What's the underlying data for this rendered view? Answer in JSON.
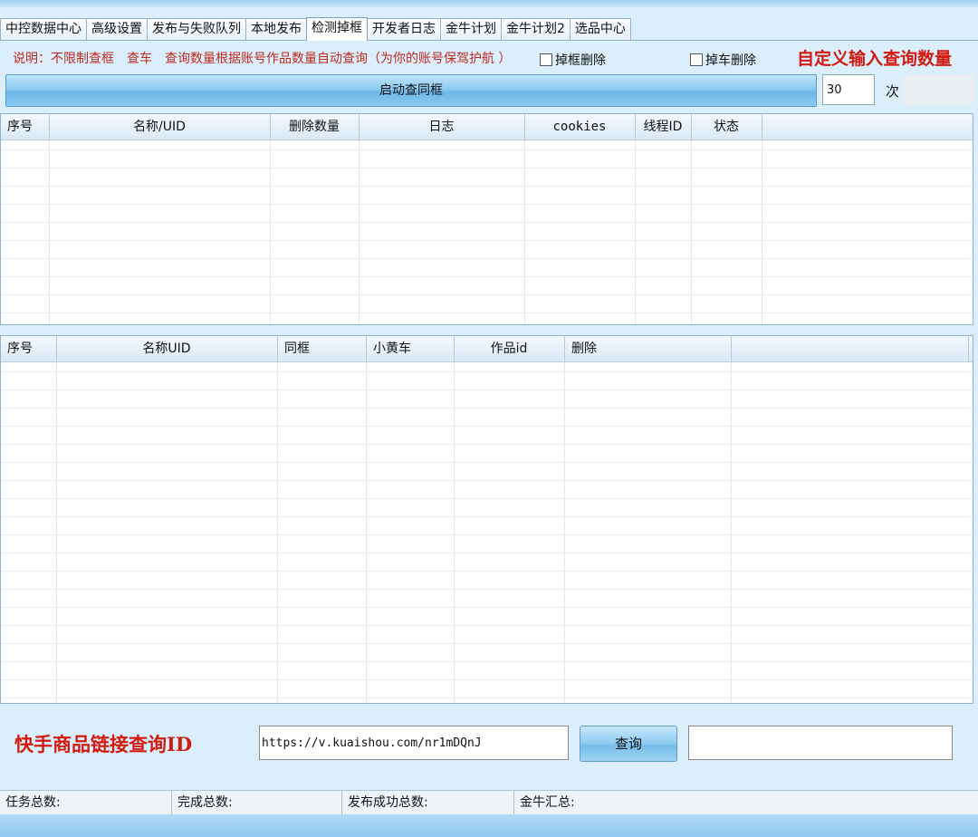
{
  "tabs": [
    "中控数据中心",
    "高级设置",
    "发布与失败队列",
    "本地发布",
    "检测掉框",
    "开发者日志",
    "金牛计划",
    "金牛计划2",
    "选品中心"
  ],
  "active_tab_index": 4,
  "note": {
    "prefix": "说明：不限制查框",
    "car": "查车",
    "desc": "查询数量根据账号作品数量自动查询（为你的账号保驾护航 ）"
  },
  "checkboxes": {
    "remove_frame": "掉框删除",
    "remove_car": "掉车删除"
  },
  "custom_query_label": "自定义输入查询数量",
  "start_button": "启动查同框",
  "query_count": "30",
  "times_unit": "次",
  "table1": {
    "headers": [
      "序号",
      "名称/UID",
      "删除数量",
      "日志",
      "cookies",
      "线程ID",
      "状态"
    ]
  },
  "table2": {
    "headers": [
      "序号",
      "名称UID",
      "同框",
      "小黄车",
      "作品id",
      "删除"
    ]
  },
  "link_query": {
    "label": "快手商品链接查询ID",
    "url_value": "https://v.kuaishou.com/nr1mDQnJ",
    "button": "查询",
    "result": ""
  },
  "status_bar": {
    "total_tasks": "任务总数:",
    "completed": "完成总数:",
    "published": "发布成功总数:",
    "jinniu": "金牛汇总:"
  },
  "colors": {
    "accent_red": "#d21a10",
    "note_red": "#c02a1e",
    "button_blue": "#8ccbf1"
  }
}
